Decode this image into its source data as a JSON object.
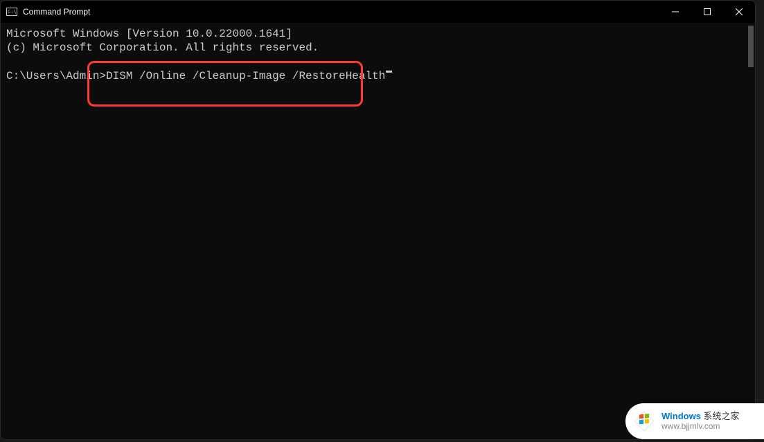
{
  "window": {
    "title": "Command Prompt"
  },
  "terminal": {
    "line1": "Microsoft Windows [Version 10.0.22000.1641]",
    "line2": "(c) Microsoft Corporation. All rights reserved.",
    "prompt": "C:\\Users\\Admin>",
    "command": "DISM /Online /Cleanup-Image /RestoreHealth"
  },
  "highlight": {
    "color": "#ff3b30"
  },
  "watermark": {
    "brand": "Windows",
    "cn": " 系统之家",
    "url": "www.bjjmlv.com"
  }
}
